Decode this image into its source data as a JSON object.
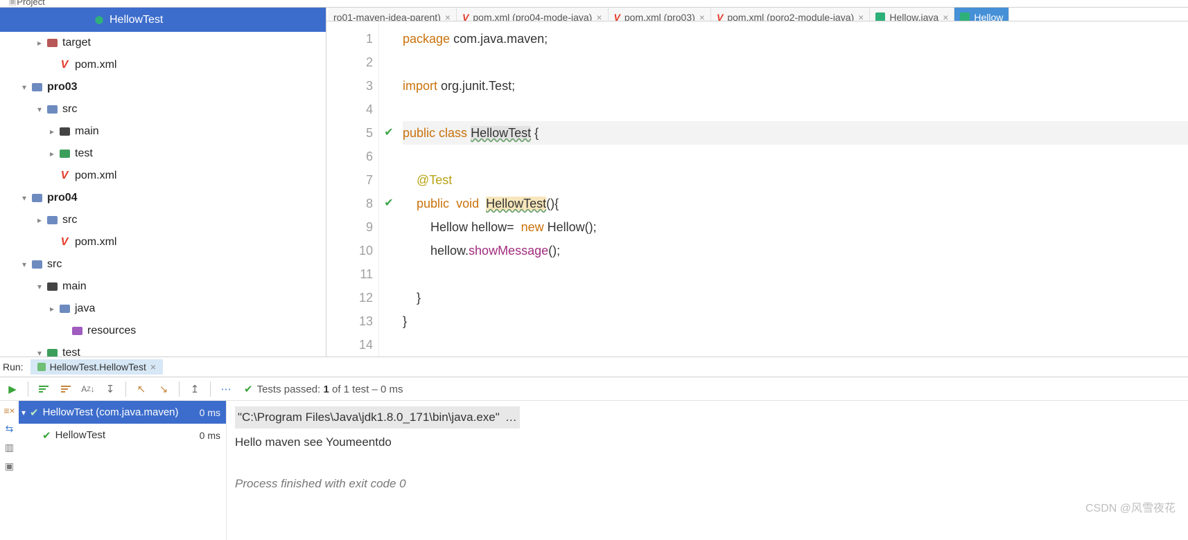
{
  "topbar_label": "Project",
  "tree": {
    "selected": "HellowTest",
    "items": [
      {
        "indent": 44,
        "chev": "right",
        "icon": "folder-c",
        "label": "target"
      },
      {
        "indent": 62,
        "icon": "v",
        "label": "pom.xml"
      },
      {
        "indent": 22,
        "chev": "down",
        "icon": "folder",
        "label": "pro03",
        "bold": true
      },
      {
        "indent": 44,
        "chev": "down",
        "icon": "folder",
        "label": "src"
      },
      {
        "indent": 62,
        "chev": "right",
        "icon": "folder-g",
        "label": "main"
      },
      {
        "indent": 62,
        "chev": "right",
        "icon": "folder-t",
        "label": "test"
      },
      {
        "indent": 62,
        "icon": "v",
        "label": "pom.xml"
      },
      {
        "indent": 22,
        "chev": "down",
        "icon": "folder",
        "label": "pro04",
        "bold": true
      },
      {
        "indent": 44,
        "chev": "right",
        "icon": "folder",
        "label": "src"
      },
      {
        "indent": 62,
        "icon": "v",
        "label": "pom.xml"
      },
      {
        "indent": 22,
        "chev": "down",
        "icon": "folder",
        "label": "src"
      },
      {
        "indent": 44,
        "chev": "down",
        "icon": "folder-g",
        "label": "main"
      },
      {
        "indent": 62,
        "chev": "right",
        "icon": "folder",
        "label": "java"
      },
      {
        "indent": 80,
        "icon": "folder-r",
        "label": "resources"
      },
      {
        "indent": 44,
        "chev": "down",
        "icon": "folder-t",
        "label": "test"
      }
    ]
  },
  "tabs": [
    {
      "icon": "none",
      "label": "ro01-maven-idea-parent)",
      "active": false,
      "partial": true
    },
    {
      "icon": "v",
      "label": "pom.xml (pro04-mode-java)",
      "active": false
    },
    {
      "icon": "v",
      "label": "pom.xml (pro03)",
      "active": false
    },
    {
      "icon": "v",
      "label": "pom.xml (poro2-module-java)",
      "active": false
    },
    {
      "icon": "j",
      "label": "Hellow.java",
      "active": false
    },
    {
      "icon": "j",
      "label": "Hellow",
      "active": true,
      "partial_right": true
    }
  ],
  "code": {
    "lines_total": 14,
    "line1": {
      "kw": "package",
      "pkg": " com.java.maven",
      ";": ";"
    },
    "line3": {
      "kw": "import",
      "pkg": " org.junit.Test",
      ";": ";"
    },
    "line5": {
      "kw1": "public",
      "kw2": "class",
      "name": "HellowTest",
      "tail": " {"
    },
    "line7": {
      "ann": "@Test"
    },
    "line8": {
      "kw1": "public",
      "kw2": "void",
      "name": "HellowTest",
      "tail": "(){"
    },
    "line9": {
      "type": "Hellow",
      "var": " hellow=  ",
      "kw": "new",
      "ctor": " Hellow",
      "tail": "();"
    },
    "line10": {
      "pre": "hellow.",
      "fn": "showMessage",
      "tail": "();"
    },
    "line11": "",
    "line12": "    }",
    "line13": "}"
  },
  "run": {
    "label": "Run:",
    "tab": "HellowTest.HellowTest",
    "status_prefix": "Tests passed: ",
    "status_count": "1",
    "status_mid": " of 1 test – ",
    "status_time": "0 ms",
    "tests": [
      {
        "label": "HellowTest (com.java.maven)",
        "ms": "0 ms",
        "sel": true,
        "chev": true
      },
      {
        "label": "HellowTest",
        "ms": "0 ms",
        "sel": false
      }
    ],
    "cmd": "\"C:\\Program Files\\Java\\jdk1.8.0_171\\bin\\java.exe\" ",
    "cmd_ell": "…",
    "out": "Hello maven see Youmeentdo",
    "exit": "Process finished with exit code 0"
  },
  "watermark": "CSDN @风雪夜花"
}
